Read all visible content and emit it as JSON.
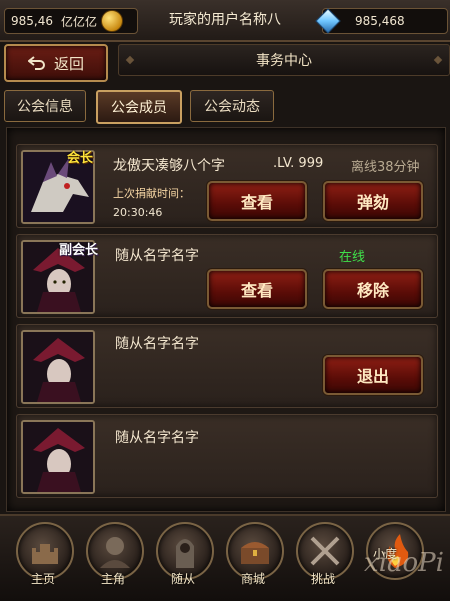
{
  "topbar": {
    "gold_amount": "985,46",
    "gold_unit": "亿亿亿",
    "player_name": "玩家的用户名称八",
    "gem_amount": "985,468"
  },
  "nav": {
    "back_label": "返回",
    "page_title": "事务中心"
  },
  "tabs": [
    {
      "label": "公会信息",
      "active": false
    },
    {
      "label": "公会成员",
      "active": true
    },
    {
      "label": "公会动态",
      "active": false
    }
  ],
  "members": [
    {
      "badge": "会长",
      "name": "龙傲天凑够八个字",
      "level": ".LV. 999",
      "status": "离线38分钟",
      "donate_label": "上次捐献时间：",
      "donate_time": "20:30:46",
      "buttons": [
        "查看",
        "弹劾"
      ]
    },
    {
      "badge": "副会长",
      "name": "随从名字名字",
      "status": "在线",
      "buttons": [
        "查看",
        "移除"
      ]
    },
    {
      "name": "随从名字名字",
      "buttons": [
        "退出"
      ]
    },
    {
      "name": "随从名字名字",
      "buttons": []
    }
  ],
  "bottom_nav": [
    {
      "label": "主页",
      "icon": "castle-icon"
    },
    {
      "label": "主角",
      "icon": "hero-icon"
    },
    {
      "label": "随从",
      "icon": "follower-icon"
    },
    {
      "label": "商城",
      "icon": "chest-icon"
    },
    {
      "label": "挑战",
      "icon": "crossed-swords-icon"
    },
    {
      "label": "小度",
      "icon": "fire-icon"
    }
  ],
  "watermark": "xiaoPi"
}
